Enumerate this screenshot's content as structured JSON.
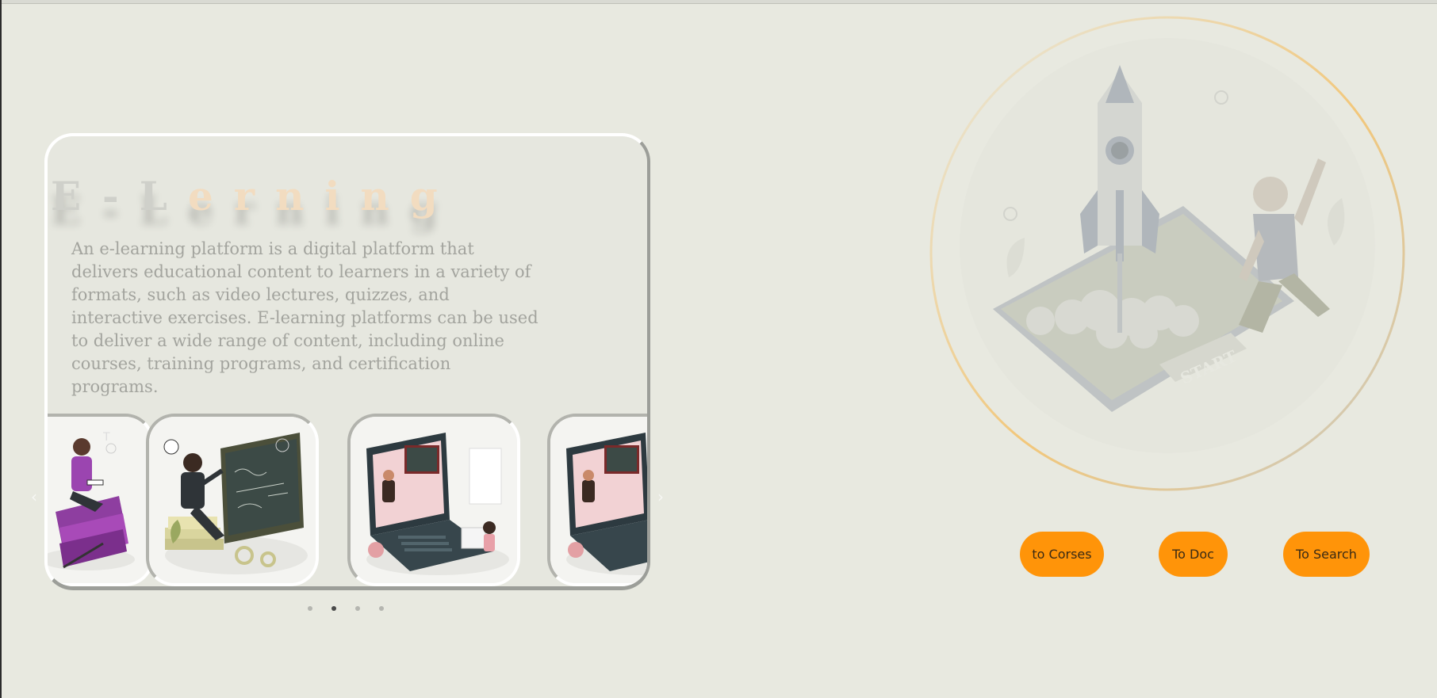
{
  "card": {
    "title_part1": "E-L",
    "title_part2": "erning",
    "description": "An e-learning platform is a digital platform that delivers educational content to learners in a variety of formats, such as video lectures, quizzes, and interactive exercises. E-learning platforms can be used to deliver a wide range of content, including online courses, training programs, and certification programs."
  },
  "carousel": {
    "prev_icon": "chevron-left-icon",
    "next_icon": "chevron-right-icon",
    "slides": [
      {
        "illustration": "reading-student-illustration"
      },
      {
        "illustration": "teacher-blackboard-illustration"
      },
      {
        "illustration": "online-class-laptop-illustration"
      },
      {
        "illustration": "online-class-laptop-illustration"
      }
    ],
    "dots_count": 4,
    "active_index": 1
  },
  "hero": {
    "illustration": "rocket-launch-start-illustration",
    "screen_text": "START"
  },
  "buttons": {
    "courses": "to Corses",
    "doc": "To Doc",
    "search": "To Search"
  },
  "colors": {
    "background": "#e8e9e0",
    "button": "#ff9409",
    "title_accent": "#f2dcc0",
    "ring": "#f2c77a"
  }
}
